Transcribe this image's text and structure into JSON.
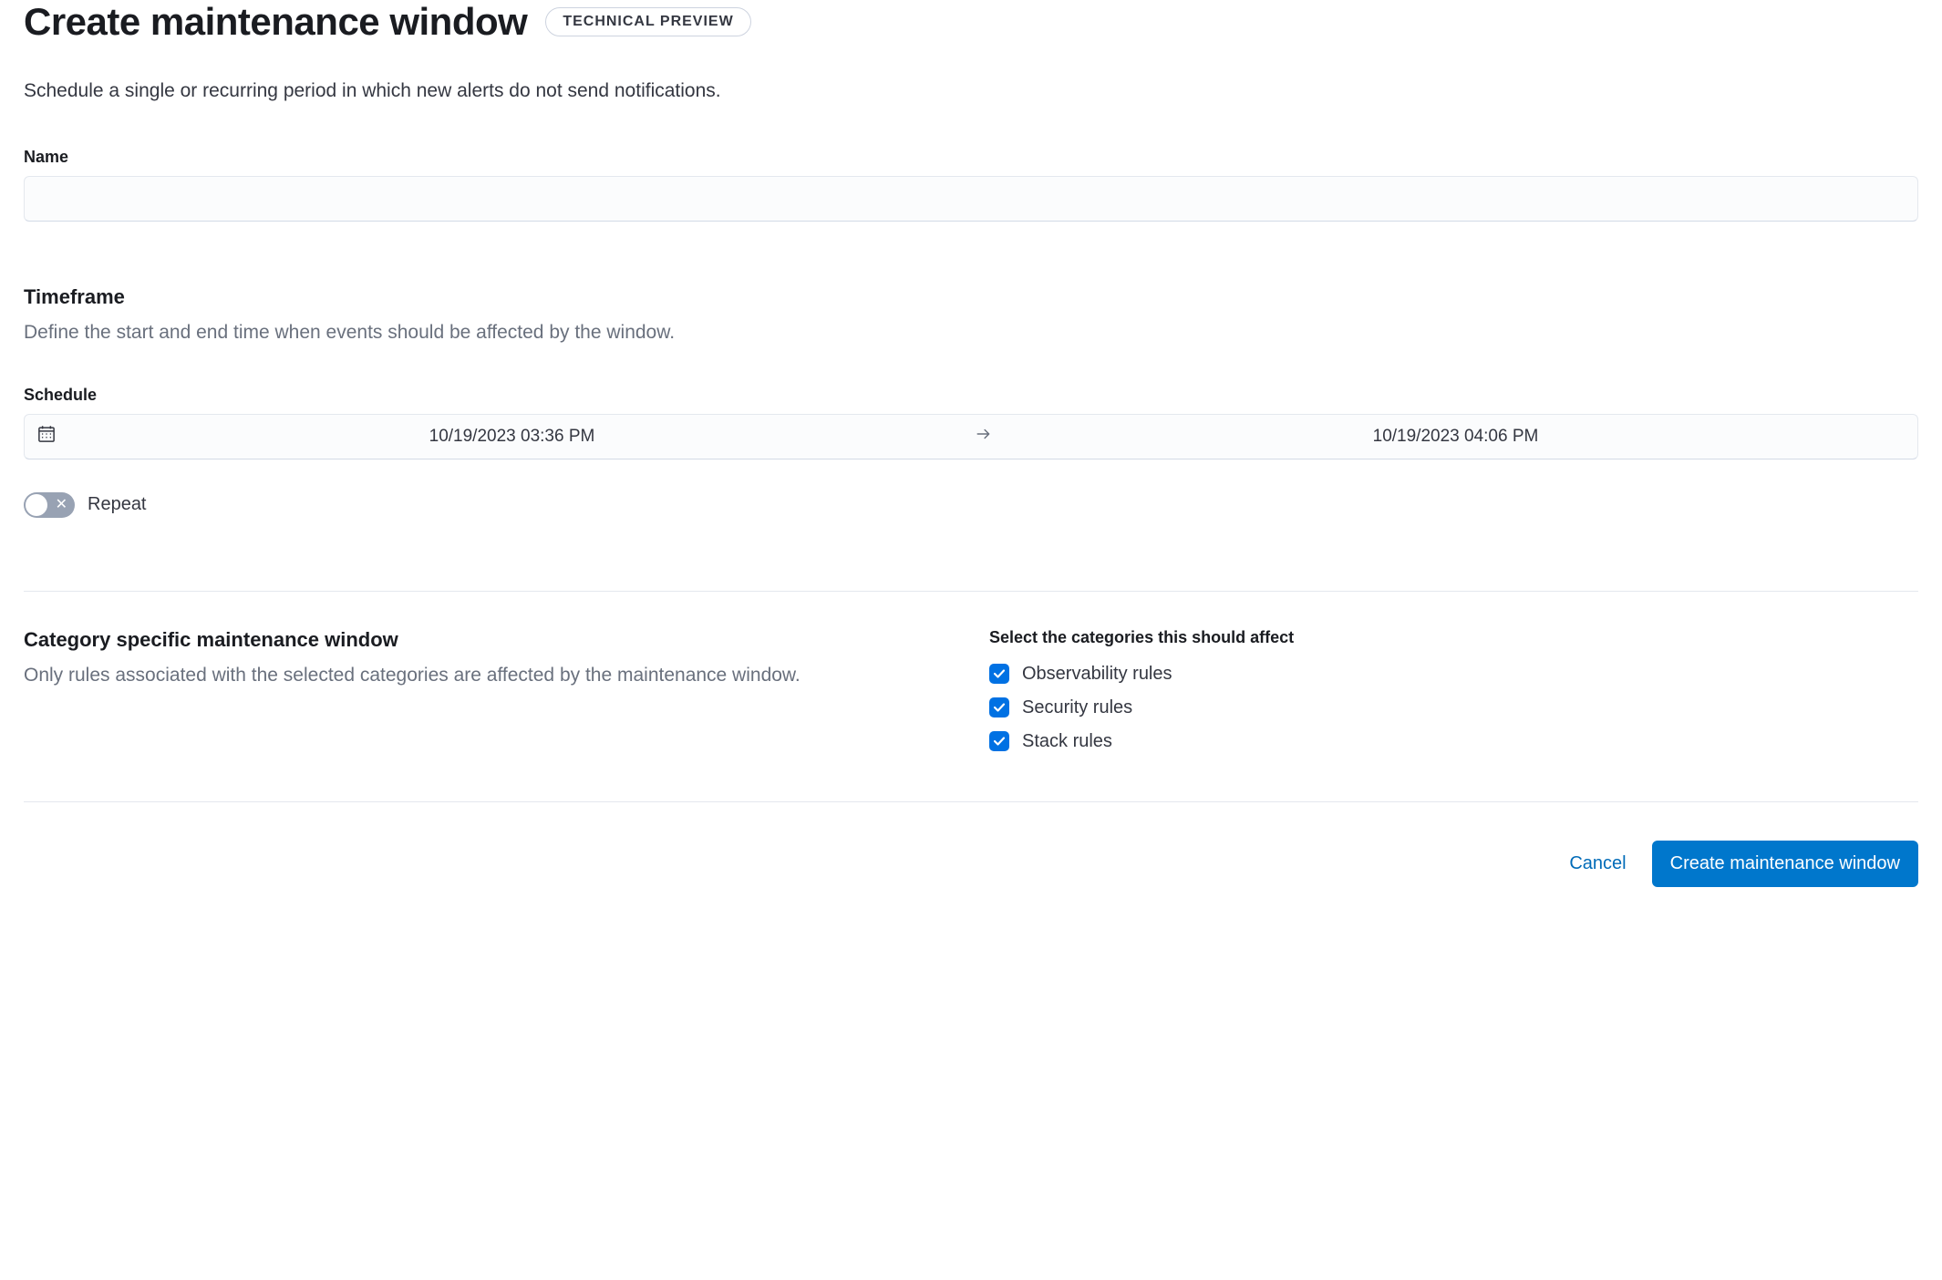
{
  "header": {
    "title": "Create maintenance window",
    "badge": "TECHNICAL PREVIEW",
    "description": "Schedule a single or recurring period in which new alerts do not send notifications."
  },
  "name": {
    "label": "Name",
    "value": ""
  },
  "timeframe": {
    "title": "Timeframe",
    "description": "Define the start and end time when events should be affected by the window.",
    "schedule_label": "Schedule",
    "start": "10/19/2023 03:36 PM",
    "end": "10/19/2023 04:06 PM",
    "repeat_label": "Repeat",
    "repeat_on": false
  },
  "category": {
    "title": "Category specific maintenance window",
    "description": "Only rules associated with the selected categories are affected by the maintenance window.",
    "instruction": "Select the categories this should affect",
    "options": [
      {
        "label": "Observability rules",
        "checked": true
      },
      {
        "label": "Security rules",
        "checked": true
      },
      {
        "label": "Stack rules",
        "checked": true
      }
    ]
  },
  "footer": {
    "cancel": "Cancel",
    "submit": "Create maintenance window"
  }
}
